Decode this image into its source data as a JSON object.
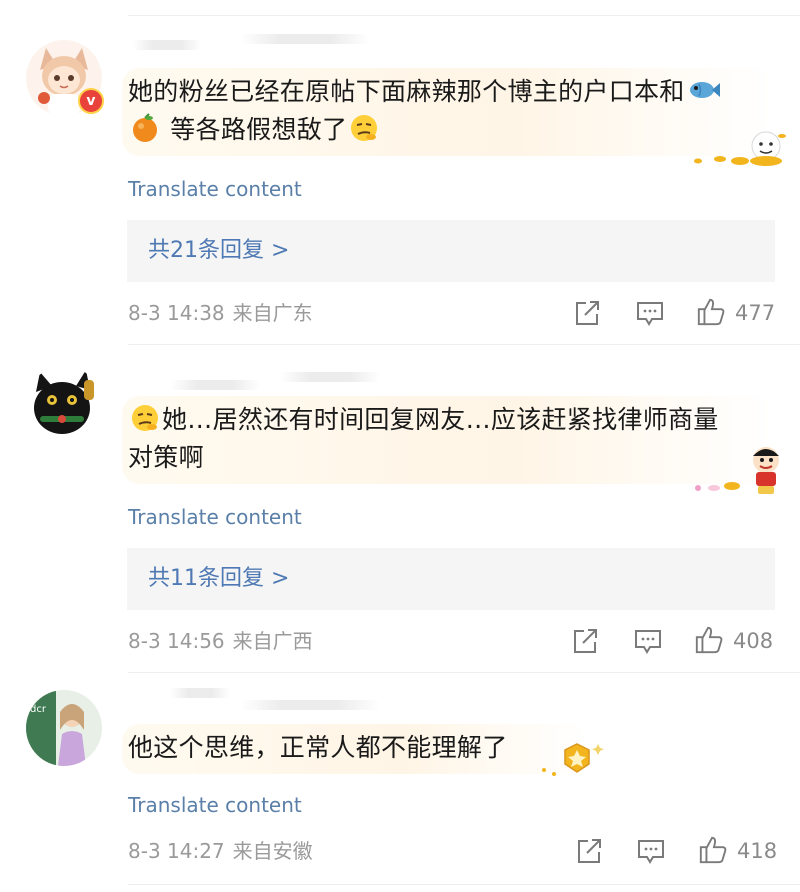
{
  "comments": [
    {
      "text": "她的粉丝已经在原帖下面麻辣那个博主的户口本和",
      "text2": "等各路假想敌了",
      "translate": "Translate content",
      "replies": "共21条回复 >",
      "time": "8-3 14:38",
      "location": "来自广东",
      "likes": "477"
    },
    {
      "text": "她…居然还有时间回复网友…应该赶紧找律师商量",
      "text2": "对策啊",
      "translate": "Translate content",
      "replies": "共11条回复 >",
      "time": "8-3 14:56",
      "location": "来自广西",
      "likes": "408"
    },
    {
      "text": "他这个思维，正常人都不能理解了",
      "translate": "Translate content",
      "time": "8-3 14:27",
      "location": "来自安徽",
      "likes": "418"
    }
  ],
  "icons": {
    "verified": "v-badge-icon",
    "share": "share-icon",
    "comment": "comment-icon",
    "like": "thumbs-up-icon",
    "fish": "fish-emoji-icon",
    "orange": "orange-emoji-icon",
    "thinking": "thinking-face-emoji-icon"
  },
  "colors": {
    "link": "#5a7fa8",
    "replies": "#4e79b4",
    "meta": "#9a9a9a",
    "verified": "#e8423a"
  }
}
